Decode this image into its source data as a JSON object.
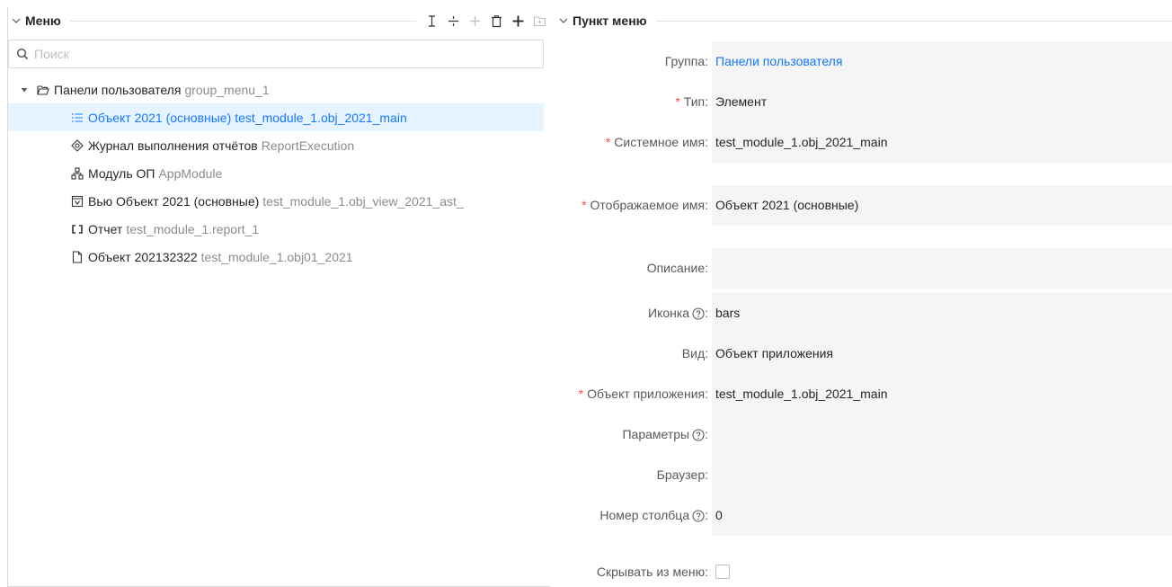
{
  "menu_panel": {
    "title": "Меню",
    "toolbar": [
      "text-cursor-icon",
      "split-icon",
      "separator-icon",
      "trash-icon",
      "plus-icon",
      "folder-add-icon"
    ]
  },
  "search": {
    "placeholder": "Поиск",
    "value": ""
  },
  "tree": {
    "root": {
      "label": "Панели пользователя",
      "sub": "group_menu_1",
      "expanded": true,
      "icon": "folder-open-icon"
    },
    "items": [
      {
        "label": "Объект 2021 (основные)",
        "sub": "test_module_1.obj_2021_main",
        "icon": "bars-icon",
        "selected": true
      },
      {
        "label": "Журнал выполнения отчётов",
        "sub": "ReportExecution",
        "icon": "target-icon",
        "selected": false
      },
      {
        "label": "Модуль ОП",
        "sub": "AppModule",
        "icon": "module-icon",
        "selected": false
      },
      {
        "label": "Вью Объект 2021 (основные)",
        "sub": "test_module_1.obj_view_2021_ast_",
        "icon": "view-icon",
        "selected": false
      },
      {
        "label": "Отчет",
        "sub": "test_module_1.report_1",
        "icon": "report-icon",
        "selected": false
      },
      {
        "label": "Объект 202132322",
        "sub": "test_module_1.obj01_2021",
        "icon": "file-icon",
        "selected": false
      }
    ]
  },
  "item_panel": {
    "title": "Пункт меню",
    "fields": [
      {
        "label": "Группа",
        "value": "Панели пользователя",
        "required": false,
        "help": false,
        "link": true
      },
      {
        "label": "Тип",
        "value": "Элемент",
        "required": true,
        "help": false
      },
      {
        "label": "Системное имя",
        "value": "test_module_1.obj_2021_main",
        "required": true,
        "help": false
      },
      {
        "label": "Отображаемое имя",
        "value": "Объект 2021 (основные)",
        "required": true,
        "help": false
      },
      {
        "label": "Описание",
        "value": "",
        "required": false,
        "help": false
      },
      {
        "label": "Иконка",
        "value": "bars",
        "required": false,
        "help": true
      },
      {
        "label": "Вид",
        "value": "Объект приложения",
        "required": false,
        "help": false
      },
      {
        "label": "Объект приложения",
        "value": "test_module_1.obj_2021_main",
        "required": true,
        "help": false
      },
      {
        "label": "Параметры",
        "value": "",
        "required": false,
        "help": true
      },
      {
        "label": "Браузер",
        "value": "",
        "required": false,
        "help": false
      },
      {
        "label": "Номер столбца",
        "value": "0",
        "required": false,
        "help": true
      },
      {
        "label": "Скрывать из меню",
        "value": "",
        "required": false,
        "help": false,
        "checkbox": true,
        "checked": false
      }
    ]
  },
  "colors": {
    "accent": "#1677ff",
    "selected_bg": "#e6f4ff",
    "required": "#ff4d4f",
    "field_bg": "#f5f5f5"
  }
}
